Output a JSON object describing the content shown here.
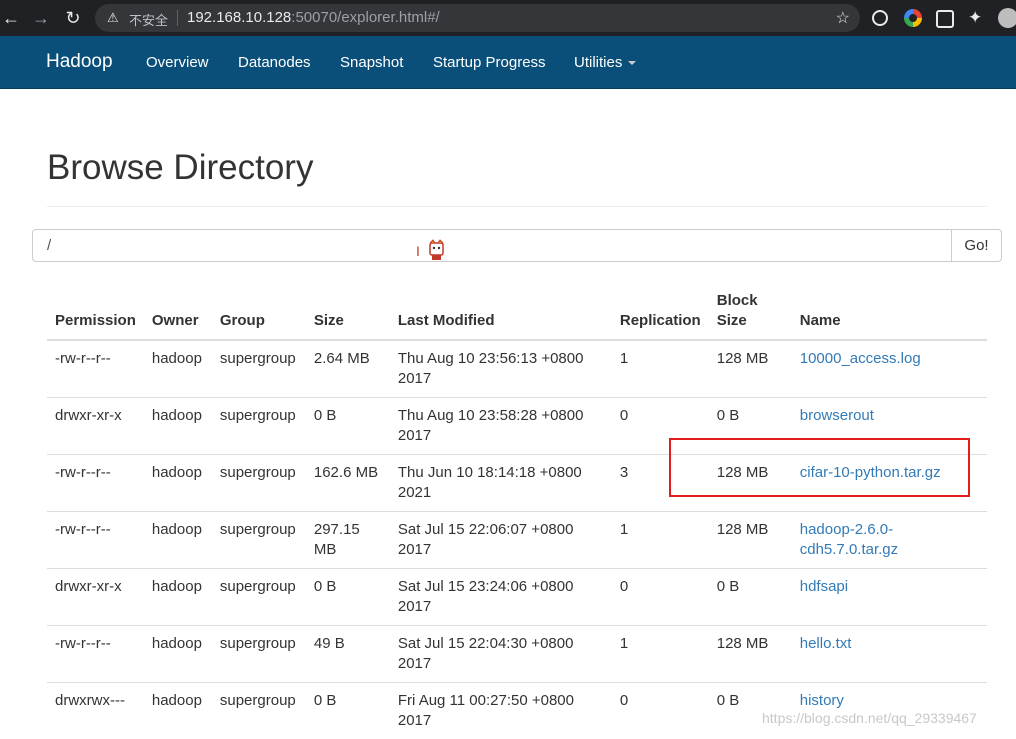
{
  "browser": {
    "insecure_label": "不安全",
    "url_host": "192.168.10.128",
    "url_rest": ":50070/explorer.html#/"
  },
  "navbar": {
    "brand": "Hadoop",
    "items": [
      "Overview",
      "Datanodes",
      "Snapshot",
      "Startup Progress",
      "Utilities"
    ]
  },
  "page": {
    "title": "Browse Directory",
    "path_value": "/",
    "go_label": "Go!"
  },
  "table": {
    "headers": [
      "Permission",
      "Owner",
      "Group",
      "Size",
      "Last Modified",
      "Replication",
      "Block Size",
      "Name"
    ],
    "rows": [
      {
        "permission": "-rw-r--r--",
        "owner": "hadoop",
        "group": "supergroup",
        "size": "2.64 MB",
        "modified": "Thu Aug 10 23:56:13 +0800 2017",
        "replication": "1",
        "block_size": "128 MB",
        "name": "10000_access.log"
      },
      {
        "permission": "drwxr-xr-x",
        "owner": "hadoop",
        "group": "supergroup",
        "size": "0 B",
        "modified": "Thu Aug 10 23:58:28 +0800 2017",
        "replication": "0",
        "block_size": "0 B",
        "name": "browserout"
      },
      {
        "permission": "-rw-r--r--",
        "owner": "hadoop",
        "group": "supergroup",
        "size": "162.6 MB",
        "modified": "Thu Jun 10 18:14:18 +0800 2021",
        "replication": "3",
        "block_size": "128 MB",
        "name": "cifar-10-python.tar.gz"
      },
      {
        "permission": "-rw-r--r--",
        "owner": "hadoop",
        "group": "supergroup",
        "size": "297.15 MB",
        "modified": "Sat Jul 15 22:06:07 +0800 2017",
        "replication": "1",
        "block_size": "128 MB",
        "name": "hadoop-2.6.0-cdh5.7.0.tar.gz"
      },
      {
        "permission": "drwxr-xr-x",
        "owner": "hadoop",
        "group": "supergroup",
        "size": "0 B",
        "modified": "Sat Jul 15 23:24:06 +0800 2017",
        "replication": "0",
        "block_size": "0 B",
        "name": "hdfsapi"
      },
      {
        "permission": "-rw-r--r--",
        "owner": "hadoop",
        "group": "supergroup",
        "size": "49 B",
        "modified": "Sat Jul 15 22:04:30 +0800 2017",
        "replication": "1",
        "block_size": "128 MB",
        "name": "hello.txt"
      },
      {
        "permission": "drwxrwx---",
        "owner": "hadoop",
        "group": "supergroup",
        "size": "0 B",
        "modified": "Fri Aug 11 00:27:50 +0800 2017",
        "replication": "0",
        "block_size": "0 B",
        "name": "history"
      }
    ]
  },
  "watermark": "https://blog.csdn.net/qq_29339467",
  "colors": {
    "navbar": "#0a4f7a",
    "link": "#337ab7",
    "highlight": "#e31d1d"
  }
}
